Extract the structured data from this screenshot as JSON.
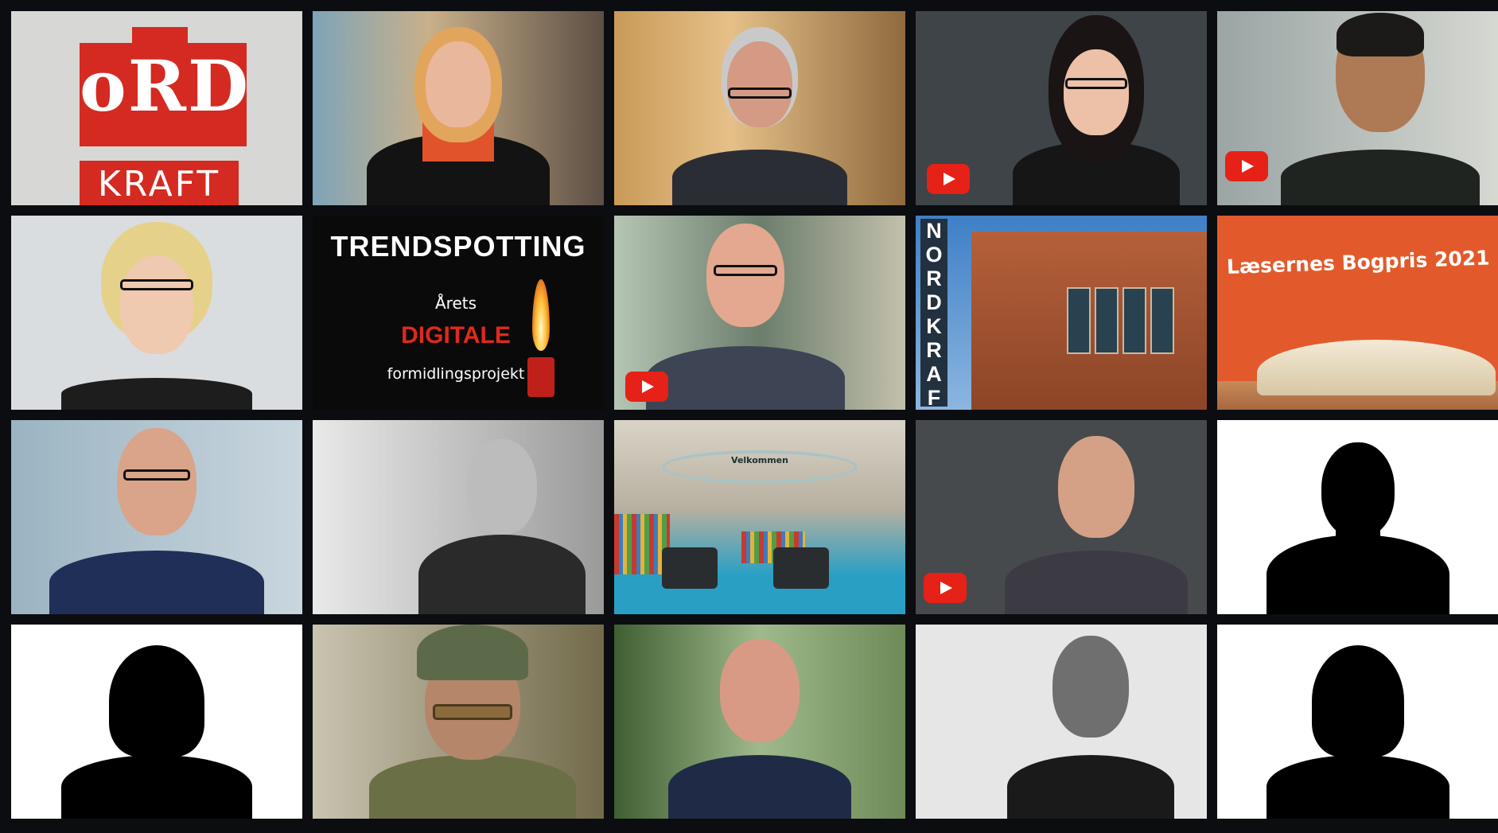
{
  "tiles": {
    "ordkraft": {
      "word1": "oRD",
      "word2": "KRAFT"
    },
    "trend": {
      "title": "TRENDSPOTTING",
      "line1": "Årets",
      "line2": "DIGITALE",
      "line3": "formidlingsprojekt"
    },
    "bogpris": {
      "text": "Læsernes Bogpris 2021"
    },
    "building": {
      "sign": "NORDKRAFT"
    },
    "library": {
      "sign": "Velkommen"
    }
  },
  "icons": {
    "play": "youtube-play-icon",
    "silhouette_male": "person-silhouette-icon",
    "silhouette_female": "person-silhouette-icon"
  },
  "colors": {
    "brand_red": "#d42a21",
    "youtube_red": "#e62117",
    "digital_red": "#e0291c",
    "bogpris_orange": "#e25a2c"
  }
}
